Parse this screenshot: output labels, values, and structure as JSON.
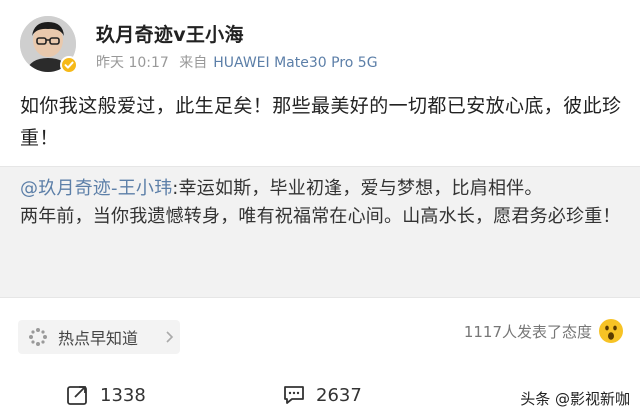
{
  "post": {
    "username": "玖月奇迹v王小海",
    "time": "昨天 10:17",
    "source_prefix": "来自",
    "device": "HUAWEI Mate30 Pro 5G",
    "text": "如你我这般爱过，此生足矣！那些最美好的一切都已安放心底，彼此珍重！"
  },
  "repost": {
    "mention": "@玖月奇迹-王小玮",
    "text": ":幸运如斯，毕业初逢，爱与梦想，比肩相伴。",
    "text2": "两年前，当你我遗憾转身，唯有祝福常在心间。山高水长，愿君务必珍重！"
  },
  "topic": {
    "label": "热点早知道"
  },
  "reactions": {
    "text": "1117人发表了态度"
  },
  "actions": {
    "repost_count": "1338",
    "comment_count": "2637"
  },
  "watermark": {
    "text": "头条 @影视新咖"
  },
  "colors": {
    "link": "#5c7fa8",
    "verified_badge": "#f6b918",
    "repost_bg": "#f2f2f2"
  },
  "icons": {
    "verified": "verified-badge-icon",
    "topic": "hot-topic-icon",
    "reaction": "surprised-emoji-icon",
    "repost": "repost-icon",
    "comment": "comment-icon"
  }
}
